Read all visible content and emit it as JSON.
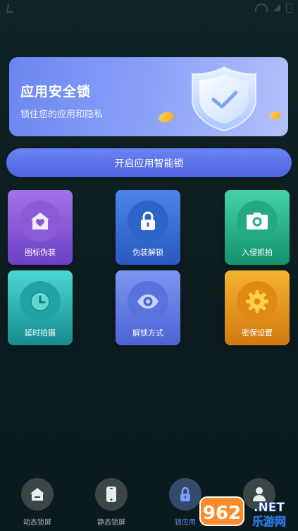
{
  "banner": {
    "title": "应用安全锁",
    "subtitle": "锁住您的应用和隐私"
  },
  "smart_lock_button": {
    "label": "开启应用智能锁"
  },
  "features": [
    {
      "label": "图标伪装",
      "icon": "home-heart-icon"
    },
    {
      "label": "伪装解锁",
      "icon": "padlock-icon"
    },
    {
      "label": "入侵抓拍",
      "icon": "camera-icon"
    },
    {
      "label": "延时拍摄",
      "icon": "clock-icon"
    },
    {
      "label": "解锁方式",
      "icon": "eye-icon"
    },
    {
      "label": "密保设置",
      "icon": "gear-icon"
    }
  ],
  "bottom_nav": [
    {
      "label": "动态锁屏",
      "icon": "home-icon",
      "active": false
    },
    {
      "label": "静态锁屏",
      "icon": "phone-icon",
      "active": false
    },
    {
      "label": "锁应用",
      "icon": "padlock-icon",
      "active": true
    },
    {
      "label": "",
      "icon": "user-icon",
      "active": false
    }
  ],
  "watermark": {
    "number": "962",
    "suffix": ".NET",
    "text": "乐游网"
  },
  "colors": {
    "background": "#0c1c1e",
    "accent": "#6a84f4",
    "tile_purple": "#8a5bd6",
    "tile_blue": "#2e63c8",
    "tile_green": "#25a982",
    "tile_cyan": "#21a2a4",
    "tile_indigo": "#5a73dc",
    "tile_orange": "#e08a16"
  }
}
